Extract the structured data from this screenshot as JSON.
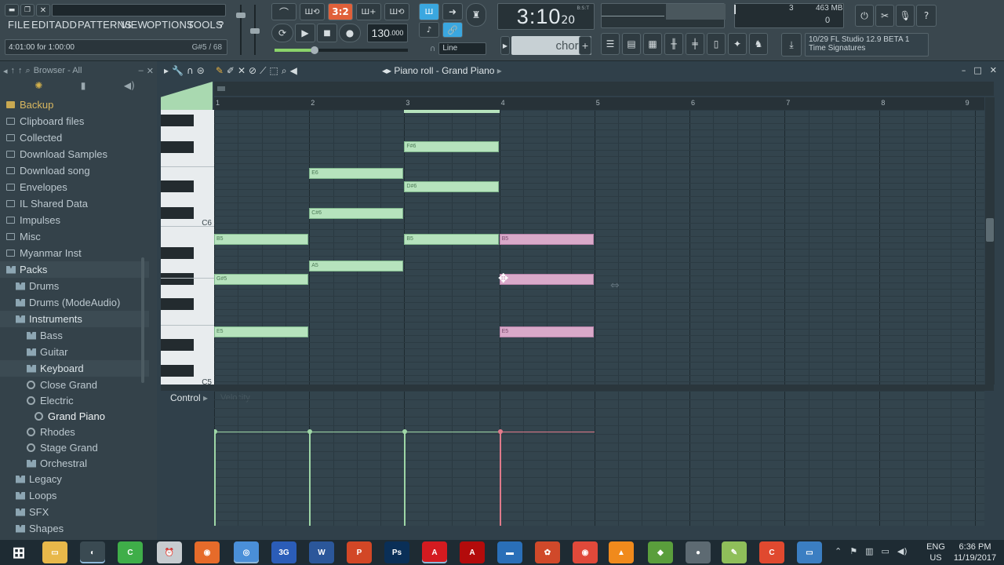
{
  "menu": [
    "FILE",
    "EDIT",
    "ADD",
    "PATTERNS",
    "VIEW",
    "OPTIONS",
    "TOOLS",
    "?"
  ],
  "status": {
    "hint": "4:01:00 for 1:00:00",
    "pattern_info": "G#5 / 68"
  },
  "transport": {
    "time": "3:10",
    "time_sub": "20",
    "time_label": "B:S:T",
    "tempo": "130",
    "tempo_dec": ".000",
    "snap": "Line",
    "tool_mode": "chord",
    "pattern_label": "3:2"
  },
  "meters": {
    "cpu": "3",
    "mem": "463 MB",
    "voices": "0"
  },
  "hint_panel": {
    "line1": "10/29  FL Studio 12.9 BETA 1",
    "line2": "Time Signatures"
  },
  "browser": {
    "title": "Browser - All",
    "items": [
      {
        "label": "Backup",
        "kind": "folder",
        "level": 0,
        "top": 0
      },
      {
        "label": "Clipboard files",
        "kind": "folder",
        "level": 0
      },
      {
        "label": "Collected",
        "kind": "folder",
        "level": 0
      },
      {
        "label": "Download Samples",
        "kind": "folder",
        "level": 0
      },
      {
        "label": "Download song",
        "kind": "folder",
        "level": 0
      },
      {
        "label": "Envelopes",
        "kind": "folder",
        "level": 0
      },
      {
        "label": "IL Shared Data",
        "kind": "folder",
        "level": 0
      },
      {
        "label": "Impulses",
        "kind": "folder",
        "level": 0
      },
      {
        "label": "Misc",
        "kind": "folder",
        "level": 0
      },
      {
        "label": "Myanmar Inst",
        "kind": "folder",
        "level": 0
      },
      {
        "label": "Packs",
        "kind": "pack",
        "level": 0
      },
      {
        "label": "Drums",
        "kind": "pack",
        "level": 1
      },
      {
        "label": "Drums (ModeAudio)",
        "kind": "pack",
        "level": 1
      },
      {
        "label": "Instruments",
        "kind": "pack",
        "level": 1
      },
      {
        "label": "Bass",
        "kind": "pack",
        "level": 2
      },
      {
        "label": "Guitar",
        "kind": "pack",
        "level": 2
      },
      {
        "label": "Keyboard",
        "kind": "pack",
        "level": 2
      },
      {
        "label": "Close Grand",
        "kind": "preset",
        "level": 2
      },
      {
        "label": "Electric",
        "kind": "preset",
        "level": 2
      },
      {
        "label": "Grand Piano",
        "kind": "preset",
        "level": 3
      },
      {
        "label": "Rhodes",
        "kind": "preset",
        "level": 2
      },
      {
        "label": "Stage Grand",
        "kind": "preset",
        "level": 2
      },
      {
        "label": "Orchestral",
        "kind": "pack",
        "level": 2
      },
      {
        "label": "Legacy",
        "kind": "pack",
        "level": 1
      },
      {
        "label": "Loops",
        "kind": "pack",
        "level": 1
      },
      {
        "label": "SFX",
        "kind": "pack",
        "level": 1
      },
      {
        "label": "Shapes",
        "kind": "pack",
        "level": 1
      }
    ]
  },
  "piano_roll": {
    "title": "Piano roll - Grand Piano",
    "bars": [
      "1",
      "2",
      "3",
      "4",
      "5",
      "6",
      "7",
      "8",
      "9"
    ],
    "key_labels": {
      "c6": "C6",
      "c5": "C5"
    },
    "control_label": "Control",
    "control_param": "Velocity",
    "notes": [
      {
        "label": "F#6",
        "bar": 3,
        "len": 1,
        "row": "f#6",
        "selected": false
      },
      {
        "label": "E6",
        "bar": 2,
        "len": 1,
        "row": "e6",
        "selected": false
      },
      {
        "label": "D#6",
        "bar": 3,
        "len": 1,
        "row": "d#6",
        "selected": false
      },
      {
        "label": "C#6",
        "bar": 2,
        "len": 1,
        "row": "c#6",
        "selected": false
      },
      {
        "label": "B5",
        "bar": 1,
        "len": 1,
        "row": "b5",
        "selected": false
      },
      {
        "label": "B5",
        "bar": 3,
        "len": 1,
        "row": "b5",
        "selected": false
      },
      {
        "label": "B5",
        "bar": 4,
        "len": 1,
        "row": "b5",
        "selected": true
      },
      {
        "label": "A5",
        "bar": 2,
        "len": 1,
        "row": "a5",
        "selected": false
      },
      {
        "label": "G#5",
        "bar": 1,
        "len": 1,
        "row": "g#5",
        "selected": false
      },
      {
        "label": "",
        "bar": 4,
        "len": 1,
        "row": "g#5",
        "selected": true
      },
      {
        "label": "E5",
        "bar": 1,
        "len": 1,
        "row": "e5",
        "selected": false
      },
      {
        "label": "E5",
        "bar": 4,
        "len": 1,
        "row": "e5",
        "selected": true
      }
    ]
  },
  "taskbar": {
    "lang": "ENG",
    "region": "US",
    "time": "6:36 PM",
    "date": "11/19/2017",
    "apps": [
      "start",
      "file-explorer",
      "fl-studio",
      "camtasia",
      "alarm",
      "firefox",
      "chrome",
      "3g",
      "word",
      "powerpoint",
      "photoshop",
      "acrobat",
      "acrobat-dc",
      "media",
      "ccleaner",
      "recorder",
      "vlc",
      "minecraft",
      "pro-app",
      "notepad",
      "camtasia-red",
      "windows-app"
    ]
  },
  "colors": {
    "note": "#b6e3bd",
    "note_selected": "#d9a9c9",
    "velocity": "#9ed6a6",
    "velocity_selected": "#e07a8a",
    "accent_blue": "#3aa7e0"
  }
}
